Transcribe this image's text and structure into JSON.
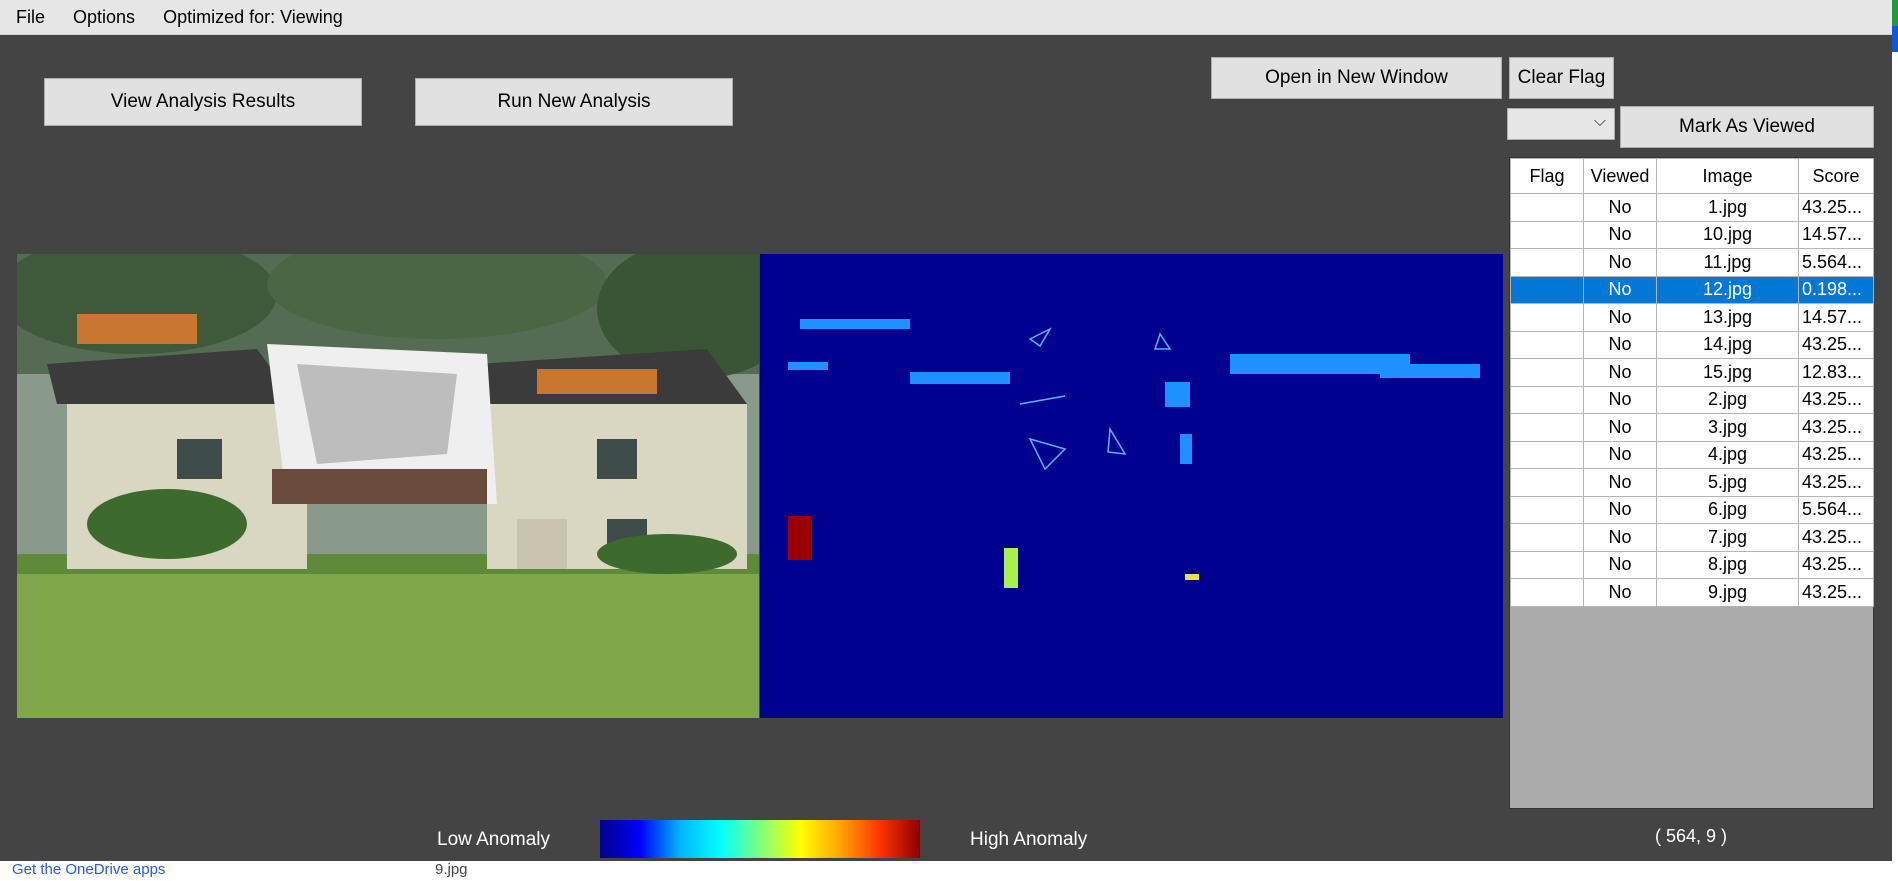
{
  "menu": {
    "file": "File",
    "options": "Options",
    "optimized": "Optimized for: Viewing"
  },
  "buttons": {
    "view_results": "View Analysis Results",
    "run_analysis": "Run New Analysis",
    "open_new_window": "Open in New Window",
    "clear_flag": "Clear Flag",
    "mark_viewed": "Mark As Viewed"
  },
  "dropdown": {
    "value": "",
    "chevron": "⌵"
  },
  "grid": {
    "columns": [
      "Flag",
      "Viewed",
      "Image",
      "Score"
    ],
    "rows": [
      {
        "flag": "",
        "viewed": "No",
        "image": "1.jpg",
        "score": "43.25..."
      },
      {
        "flag": "",
        "viewed": "No",
        "image": "10.jpg",
        "score": "14.57..."
      },
      {
        "flag": "",
        "viewed": "No",
        "image": "11.jpg",
        "score": "5.564..."
      },
      {
        "flag": "",
        "viewed": "No",
        "image": "12.jpg",
        "score": "0.198..."
      },
      {
        "flag": "",
        "viewed": "No",
        "image": "13.jpg",
        "score": "14.57..."
      },
      {
        "flag": "",
        "viewed": "No",
        "image": "14.jpg",
        "score": "43.25..."
      },
      {
        "flag": "",
        "viewed": "No",
        "image": "15.jpg",
        "score": "12.83..."
      },
      {
        "flag": "",
        "viewed": "No",
        "image": "2.jpg",
        "score": "43.25..."
      },
      {
        "flag": "",
        "viewed": "No",
        "image": "3.jpg",
        "score": "43.25..."
      },
      {
        "flag": "",
        "viewed": "No",
        "image": "4.jpg",
        "score": "43.25..."
      },
      {
        "flag": "",
        "viewed": "No",
        "image": "5.jpg",
        "score": "43.25..."
      },
      {
        "flag": "",
        "viewed": "No",
        "image": "6.jpg",
        "score": "5.564..."
      },
      {
        "flag": "",
        "viewed": "No",
        "image": "7.jpg",
        "score": "43.25..."
      },
      {
        "flag": "",
        "viewed": "No",
        "image": "8.jpg",
        "score": "43.25..."
      },
      {
        "flag": "",
        "viewed": "No",
        "image": "9.jpg",
        "score": "43.25..."
      }
    ],
    "selected_index": 3
  },
  "legend": {
    "low": "Low Anomaly",
    "high": "High Anomaly"
  },
  "cursor_coords": "( 564, 9 )",
  "background_strip": {
    "link": "Get the OneDrive apps",
    "file": "9.jpg"
  },
  "colors": {
    "window_bg": "#444444",
    "heatmap_bg": "#00008f",
    "selection": "#0078d7"
  }
}
